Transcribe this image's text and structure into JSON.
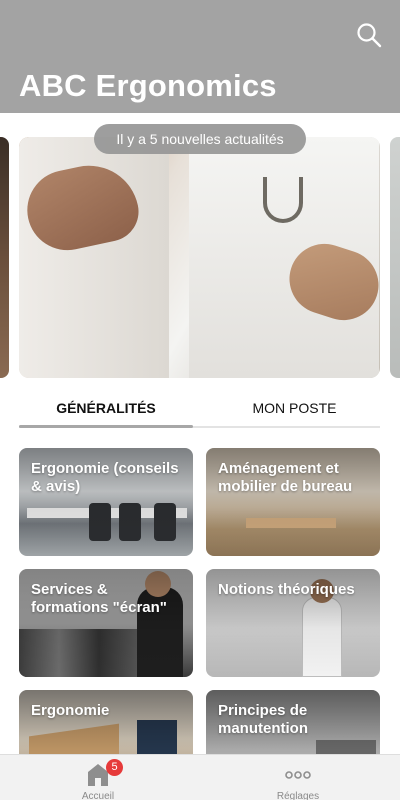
{
  "app": {
    "title": "ABC Ergonomics"
  },
  "header": {
    "search_icon": "search-icon"
  },
  "carousel": {
    "news_pill": "Il y a 5 nouvelles actualités"
  },
  "tabs": [
    {
      "label": "GÉNÉRALITÉS",
      "selected": true
    },
    {
      "label": "MON POSTE",
      "selected": false
    }
  ],
  "cards": [
    {
      "label": "Ergonomie (conseils & avis)"
    },
    {
      "label": "Aménagement et mobilier de bureau"
    },
    {
      "label": "Services & formations \"écran\""
    },
    {
      "label": "Notions théoriques"
    },
    {
      "label": "Ergonomie"
    },
    {
      "label": "Principes de manutention"
    }
  ],
  "tabbar": {
    "home_label": "Accueil",
    "home_badge": "5",
    "settings_label": "Réglages",
    "home_icon": "home-icon",
    "settings_icon": "more-dots-icon"
  },
  "colors": {
    "header_bg": "#a3a3a3",
    "badge": "#e63a3a",
    "tab_indicator": "#a7a7a7"
  }
}
